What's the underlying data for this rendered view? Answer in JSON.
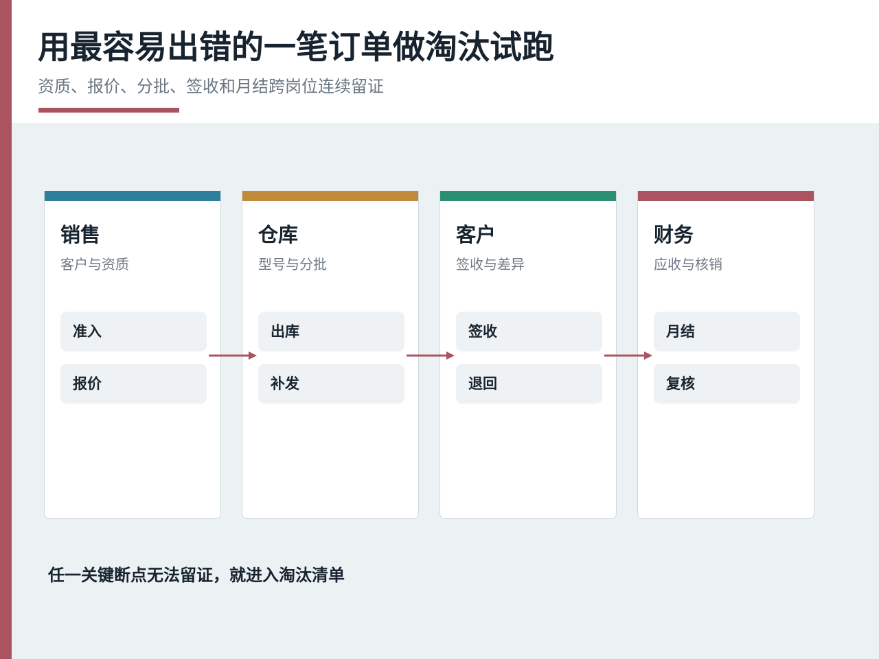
{
  "header": {
    "title": "用最容易出错的一笔订单做淘汰试跑",
    "subtitle": "资质、报价、分批、签收和月结跨岗位连续留证"
  },
  "colors": {
    "accent": "#ab5361",
    "sales": "#2e7f9c",
    "warehouse": "#c08b3a",
    "customer": "#2d8f72",
    "finance": "#ab5361"
  },
  "stages": [
    {
      "title": "销售",
      "subtitle": "客户与资质",
      "steps": [
        "准入",
        "报价"
      ]
    },
    {
      "title": "仓库",
      "subtitle": "型号与分批",
      "steps": [
        "出库",
        "补发"
      ]
    },
    {
      "title": "客户",
      "subtitle": "签收与差异",
      "steps": [
        "签收",
        "退回"
      ]
    },
    {
      "title": "财务",
      "subtitle": "应收与核销",
      "steps": [
        "月结",
        "复核"
      ]
    }
  ],
  "footer": {
    "note": "任一关键断点无法留证，就进入淘汰清单"
  }
}
